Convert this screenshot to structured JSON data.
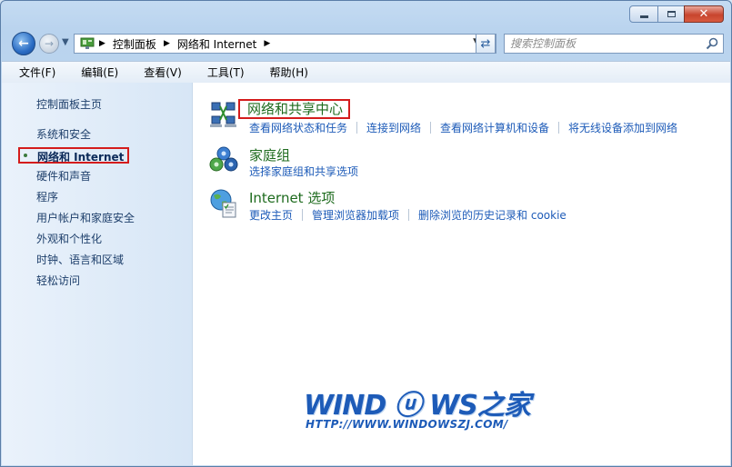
{
  "window": {
    "caption": {
      "minimize": "—",
      "maximize": "☐",
      "close": "✕"
    }
  },
  "navigation": {
    "back_icon": "back-arrow-icon",
    "forward_icon": "forward-arrow-icon",
    "breadcrumbs": [
      "控制面板",
      "网络和 Internet"
    ],
    "search_placeholder": "搜索控制面板"
  },
  "menu": [
    "文件(F)",
    "编辑(E)",
    "查看(V)",
    "工具(T)",
    "帮助(H)"
  ],
  "sidebar": {
    "home": "控制面板主页",
    "items": [
      "系统和安全",
      "网络和 Internet",
      "硬件和声音",
      "程序",
      "用户帐户和家庭安全",
      "外观和个性化",
      "时钟、语言和区域",
      "轻松访问"
    ],
    "current_index": 1
  },
  "categories": [
    {
      "title": "网络和共享中心",
      "icon": "network-sharing-icon",
      "links": [
        "查看网络状态和任务",
        "连接到网络",
        "查看网络计算机和设备",
        "将无线设备添加到网络"
      ]
    },
    {
      "title": "家庭组",
      "icon": "homegroup-icon",
      "links": [
        "选择家庭组和共享选项"
      ]
    },
    {
      "title": "Internet 选项",
      "icon": "internet-options-icon",
      "links": [
        "更改主页",
        "管理浏览器加载项",
        "删除浏览的历史记录和 cookie"
      ]
    }
  ],
  "watermark": {
    "logo": "WIND ⓤ WS之家",
    "url": "HTTP://WWW.WINDOWSZJ.COM/"
  },
  "colors": {
    "accent_link": "#1d5bb8",
    "category_title": "#1e6b1e",
    "highlight_box": "#d41c1c"
  }
}
